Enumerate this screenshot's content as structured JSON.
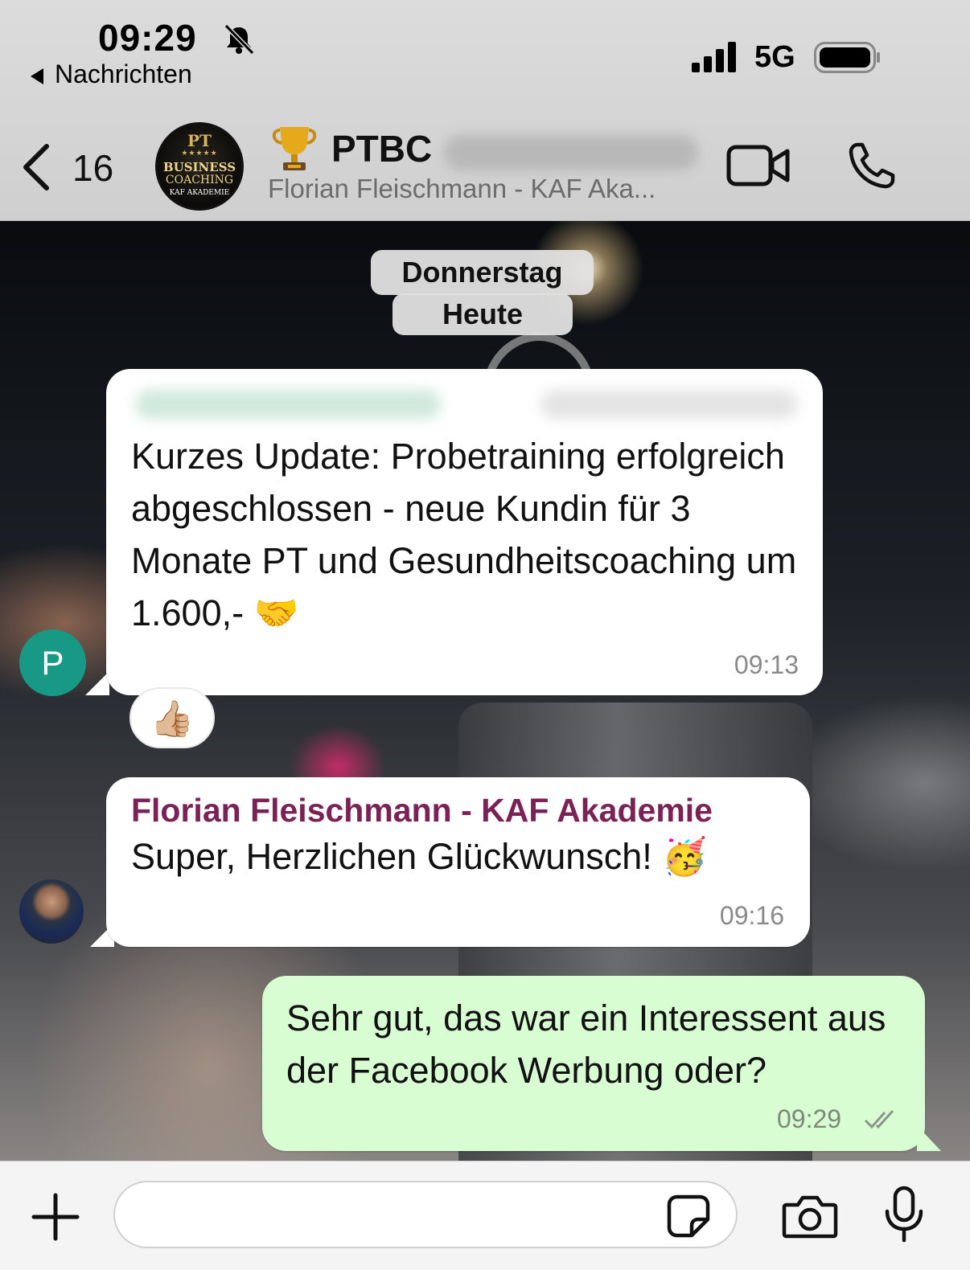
{
  "status_bar": {
    "time": "09:29",
    "back_app": "Nachrichten",
    "network": "5G"
  },
  "header": {
    "unread_count": "16",
    "group_name": "PTBC",
    "subtitle": "Florian Fleischmann - KAF Aka...",
    "avatar_logo": {
      "line1": "PT",
      "stars": "★★★★★",
      "line2": "BUSINESS",
      "line3": "COACHING",
      "line4": "KAF AKADEMIE"
    }
  },
  "date_pills": [
    "Donnerstag",
    "Heute"
  ],
  "messages": [
    {
      "avatar_letter": "P",
      "text": "Kurzes Update: Probetraining erfolgreich abgeschlossen - neue Kundin für 3 Monate PT und Gesundheitscoaching um 1.600,- 🤝",
      "time": "09:13",
      "reaction": "👍🏼"
    },
    {
      "sender": "Florian Fleischmann - KAF Akademie",
      "text": "Super, Herzlichen Glückwunsch! 🥳",
      "time": "09:16"
    },
    {
      "text": "Sehr gut, das war ein Interessent aus der Facebook Werbung oder?",
      "time": "09:29",
      "status": "read"
    }
  ],
  "icons": {
    "back": "chevron-left-icon",
    "video": "video-camera-icon",
    "call": "phone-icon",
    "plus": "plus-icon",
    "sticker": "sticker-icon",
    "camera": "camera-icon",
    "mic": "microphone-icon",
    "mute": "bell-slash-icon",
    "trophy": "trophy-icon"
  },
  "colors": {
    "outgoing_bubble": "#d9fdd3",
    "incoming_bubble": "#ffffff",
    "sender_name": "#7a2155",
    "avatar_p": "#179985"
  }
}
